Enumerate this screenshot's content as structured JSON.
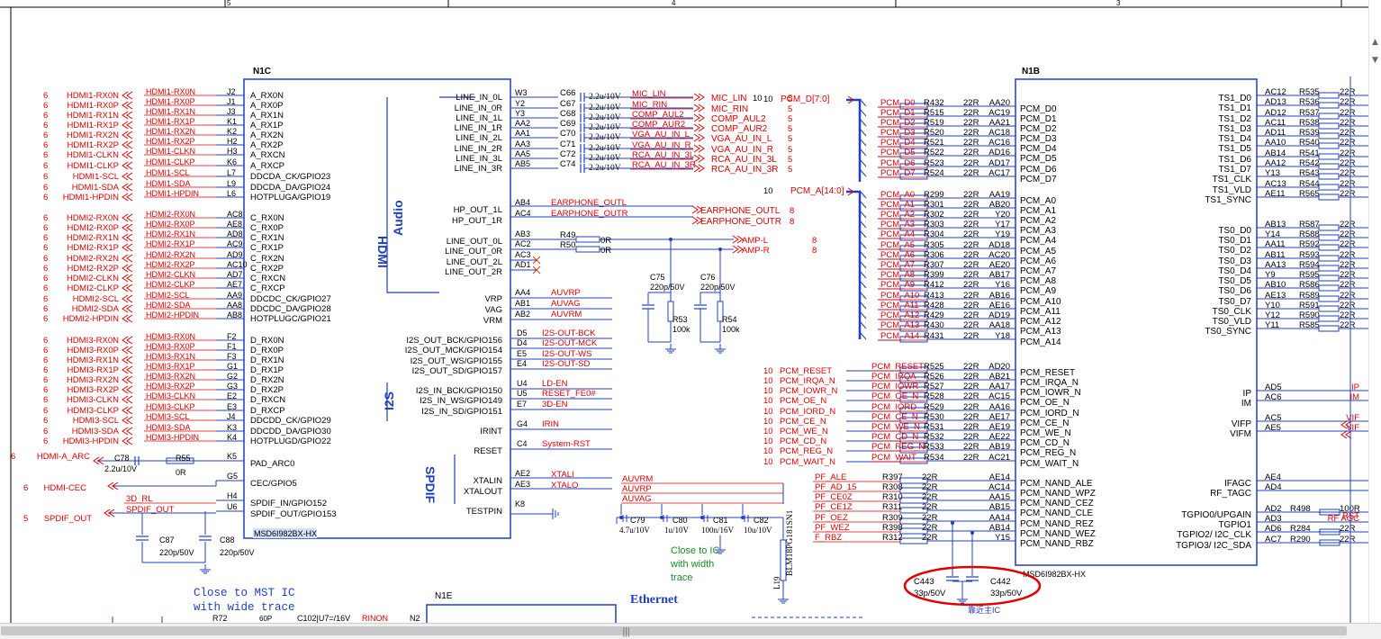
{
  "colors": {
    "wire": "#1f3fbf",
    "label": "#e00000",
    "pin": "#000000",
    "ring": "#e00000"
  },
  "frame": {
    "cols": [
      "5",
      "4",
      "3"
    ]
  },
  "n1c": {
    "title": "N1C",
    "part": "MSD6I982BX-HX",
    "section_audio": "Audio",
    "section_audio2": "HDMI",
    "section_i2s": "I2S",
    "section_spdif": "SPDIF",
    "left": [
      {
        "ball": "J2",
        "pin": "A_RX0N",
        "net": "HDMI1-RX0N",
        "ext": "HDMI1-RX0N",
        "sheet": "6"
      },
      {
        "ball": "J1",
        "pin": "A_RX0P",
        "net": "HDMI1-RX0P",
        "ext": "HDMI1-RX0P",
        "sheet": "6"
      },
      {
        "ball": "J3",
        "pin": "A_RX1N",
        "net": "HDMI1-RX1N",
        "ext": "HDMI1-RX1N",
        "sheet": "6"
      },
      {
        "ball": "K1",
        "pin": "A_RX1P",
        "net": "HDMI1-RX1P",
        "ext": "HDMI1-RX1P",
        "sheet": "6"
      },
      {
        "ball": "K2",
        "pin": "A_RX2N",
        "net": "HDMI1-RX2N",
        "ext": "HDMI1-RX2N",
        "sheet": "6"
      },
      {
        "ball": "H2",
        "pin": "A_RX2P",
        "net": "HDMI1-RX2P",
        "ext": "HDMI1-RX2P",
        "sheet": "6"
      },
      {
        "ball": "H3",
        "pin": "A_RXCN",
        "net": "HDMI1-CLKN",
        "ext": "HDMI1-CLKN",
        "sheet": "6"
      },
      {
        "ball": "K6",
        "pin": "A_RXCP",
        "net": "HDMI1-CLKP",
        "ext": "HDMI1-CLKP",
        "sheet": "6"
      },
      {
        "ball": "L7",
        "pin": "DDCDA_CK/GPIO23",
        "net": "HDMI1-SCL",
        "ext": "HDMI1-SCL",
        "sheet": "6"
      },
      {
        "ball": "L9",
        "pin": "DDCDA_DA/GPIO24",
        "net": "HDMI1-SDA",
        "ext": "HDMI1-SDA",
        "sheet": "6"
      },
      {
        "ball": "L6",
        "pin": "HOTPLUGA/GPIO19",
        "net": "HDMI1-HPDIN",
        "ext": "HDMI1-HPDIN",
        "sheet": "6"
      },
      {
        "ball": "AC8",
        "pin": "C_RX0N",
        "net": "HDMI2-RX0N",
        "ext": "HDMI2-RX0N",
        "sheet": "6"
      },
      {
        "ball": "AE8",
        "pin": "C_RX0P",
        "net": "HDMI2-RX0P",
        "ext": "HDMI2-RX0P",
        "sheet": "6"
      },
      {
        "ball": "AD8",
        "pin": "C_RX1N",
        "net": "HDMI2-RX1N",
        "ext": "HDMI2-RX1N",
        "sheet": "6"
      },
      {
        "ball": "AC9",
        "pin": "C_RX1P",
        "net": "HDMI2-RX1P",
        "ext": "HDMI2-RX1P",
        "sheet": "6"
      },
      {
        "ball": "AD9",
        "pin": "C_RX2N",
        "net": "HDMI2-RX2N",
        "ext": "HDMI2-RX2N",
        "sheet": "6"
      },
      {
        "ball": "AC10",
        "pin": "C_RX2P",
        "net": "HDMI2-RX2P",
        "ext": "HDMI2-RX2P",
        "sheet": "6"
      },
      {
        "ball": "AD7",
        "pin": "C_RXCN",
        "net": "HDMI2-CLKN",
        "ext": "HDMI2-CLKN",
        "sheet": "6"
      },
      {
        "ball": "AE7",
        "pin": "C_RXCP",
        "net": "HDMI2-CLKP",
        "ext": "HDMI2-CLKP",
        "sheet": "6"
      },
      {
        "ball": "AA9",
        "pin": "DDCDC_CK/GPIO27",
        "net": "HDMI2-SCL",
        "ext": "HDMI2-SCL",
        "sheet": "6"
      },
      {
        "ball": "AA8",
        "pin": "DDCDC_DA/GPIO28",
        "net": "HDMI2-SDA",
        "ext": "HDMI2-SDA",
        "sheet": "6"
      },
      {
        "ball": "AB8",
        "pin": "HOTPLUGC/GPIO21",
        "net": "HDMI2-HPDIN",
        "ext": "HDMI2-HPDIN",
        "sheet": "6"
      },
      {
        "ball": "F2",
        "pin": "D_RX0N",
        "net": "HDMI3-RX0N",
        "ext": "HDMI3-RX0N",
        "sheet": "6"
      },
      {
        "ball": "F1",
        "pin": "D_RX0P",
        "net": "HDMI3-RX0P",
        "ext": "HDMI3-RX0P",
        "sheet": "6"
      },
      {
        "ball": "F3",
        "pin": "D_RX1N",
        "net": "HDMI3-RX1N",
        "ext": "HDMI3-RX1N",
        "sheet": "6"
      },
      {
        "ball": "G1",
        "pin": "D_RX1P",
        "net": "HDMI3-RX1P",
        "ext": "HDMI3-RX1P",
        "sheet": "6"
      },
      {
        "ball": "G2",
        "pin": "D_RX2N",
        "net": "HDMI3-RX2N",
        "ext": "HDMI3-RX2N",
        "sheet": "6"
      },
      {
        "ball": "G3",
        "pin": "D_RX2P",
        "net": "HDMI3-RX2P",
        "ext": "HDMI3-RX2P",
        "sheet": "6"
      },
      {
        "ball": "E2",
        "pin": "D_RXCN",
        "net": "HDMI3-CLKN",
        "ext": "HDMI3-CLKN",
        "sheet": "6"
      },
      {
        "ball": "E3",
        "pin": "D_RXCP",
        "net": "HDMI3-CLKP",
        "ext": "HDMI3-CLKP",
        "sheet": "6"
      },
      {
        "ball": "J4",
        "pin": "DDCDD_CK/GPIO29",
        "net": "HDMI3-SCL",
        "ext": "HDMI3-SCL",
        "sheet": "6"
      },
      {
        "ball": "K3",
        "pin": "DDCDD_DA/GPIO30",
        "net": "HDMI3-SDA",
        "ext": "HDMI3-SDA",
        "sheet": "6"
      },
      {
        "ball": "K4",
        "pin": "HOTPLUGD/GPIO22",
        "net": "HDMI3-HPDIN",
        "ext": "HDMI3-HPDIN",
        "sheet": "6"
      }
    ],
    "left_misc": [
      {
        "ball": "K5",
        "pin": "PAD_ARC0",
        "ext": "HDMI-A_ARC",
        "sheet": "6"
      },
      {
        "ball": "G5",
        "pin": "CEC/GPIO5",
        "ext": "HDMI-CEC",
        "sheet": "6"
      },
      {
        "ball": "H4",
        "pin": "SPDIF_IN/GPIO152",
        "ext": "3D_RL",
        "sheet": ""
      },
      {
        "ball": "U6",
        "pin": "SPDIF_OUT/GPIO153",
        "ext": "SPDIF_OUT",
        "sheet": "5"
      }
    ],
    "right": [
      {
        "ball": "W3",
        "pin": "LINE_IN_0L",
        "ref": "C66",
        "val": "2.2u/10V",
        "net": "MIC_LIN",
        "ext": "MIC_LIN",
        "sheet": "5"
      },
      {
        "ball": "Y2",
        "pin": "LINE_IN_0R",
        "ref": "C67",
        "val": "2.2u/10V",
        "net": "MIC_RIN",
        "ext": "MIC_RIN",
        "sheet": "5"
      },
      {
        "ball": "Y3",
        "pin": "LINE_IN_1L",
        "ref": "C68",
        "val": "2.2u/10V",
        "net": "COMP_AUL2",
        "ext": "COMP_AUL2",
        "sheet": "5"
      },
      {
        "ball": "AA2",
        "pin": "LINE_IN_1R",
        "ref": "C69",
        "val": "2.2u/10V",
        "net": "COMP_AUR2",
        "ext": "COMP_AUR2",
        "sheet": "5"
      },
      {
        "ball": "AA1",
        "pin": "LINE_IN_2L",
        "ref": "C70",
        "val": "2.2u/10V",
        "net": "VGA_AU_IN_L",
        "ext": "VGA_AU_IN_L",
        "sheet": "5"
      },
      {
        "ball": "AA3",
        "pin": "LINE_IN_2R",
        "ref": "C71",
        "val": "2.2u/10V",
        "net": "VGA_AU_IN_R",
        "ext": "VGA_AU_IN_R",
        "sheet": "5"
      },
      {
        "ball": "AA5",
        "pin": "LINE_IN_3L",
        "ref": "C72",
        "val": "2.2u/10V",
        "net": "RCA_AU_IN_3L",
        "ext": "RCA_AU_IN_3L",
        "sheet": "5"
      },
      {
        "ball": "AB5",
        "pin": "LINE_IN_3R",
        "ref": "C74",
        "val": "2.2u/10V",
        "net": "RCA_AU_IN_3R",
        "ext": "RCA_AU_IN_3R",
        "sheet": "5"
      }
    ],
    "hp": [
      {
        "ball": "AB4",
        "pin": "HP_OUT_1L",
        "net": "EARPHONE_OUTL",
        "sheet": "8"
      },
      {
        "ball": "AC4",
        "pin": "HP_OUT_1R",
        "net": "EARPHONE_OUTR",
        "sheet": "8"
      }
    ],
    "lineout": [
      {
        "ball": "AB3",
        "pin": "LINE_OUT_0L",
        "ref": "R49",
        "val": "0R",
        "ext": "AMP-L",
        "sheet": "8"
      },
      {
        "ball": "AC2",
        "pin": "LINE_OUT_0R",
        "ref": "R50",
        "val": "0R",
        "ext": "AMP-R",
        "sheet": "8"
      },
      {
        "ball": "AC3",
        "pin": "LINE_OUT_2L"
      },
      {
        "ball": "AD1",
        "pin": "LINE_OUT_2R"
      }
    ],
    "vref": [
      {
        "ball": "AA4",
        "pin": "VRP",
        "net": "AUVRP"
      },
      {
        "ball": "AB1",
        "pin": "VAG",
        "net": "AUVAG"
      },
      {
        "ball": "AB2",
        "pin": "VRM",
        "net": "AUVRM"
      }
    ],
    "i2s": [
      {
        "ball": "D5",
        "pin": "I2S_OUT_BCK/GPIO156",
        "net": "I2S-OUT-BCK"
      },
      {
        "ball": "D4",
        "pin": "I2S_OUT_MCK/GPIO154",
        "net": "I2S-OUT-MCK"
      },
      {
        "ball": "E5",
        "pin": "I2S_OUT_WS/GPIO155",
        "net": "I2S-OUT-WS"
      },
      {
        "ball": "E4",
        "pin": "I2S_OUT_SD/GPIO157",
        "net": "I2S-OUT-SD"
      },
      {
        "ball": "U4",
        "pin": "I2S_IN_BCK/GPIO150",
        "net": "LD-EN"
      },
      {
        "ball": "U5",
        "pin": "I2S_IN_WS/GPIO149",
        "net": "RESET_FE0#"
      },
      {
        "ball": "E7",
        "pin": "I2S_IN_SD/GPIO151",
        "net": "3D-EN"
      },
      {
        "ball": "G4",
        "pin": "IRINT",
        "net": "IRIN"
      },
      {
        "ball": "C4",
        "pin": "RESET",
        "net": "System-RST"
      }
    ],
    "xtal": [
      {
        "ball": "AE2",
        "pin": "XTALIN",
        "net": "XTALI"
      },
      {
        "ball": "AE3",
        "pin": "XTALOUT",
        "net": "XTALO"
      },
      {
        "ball": "K8",
        "pin": "TESTPIN",
        "net": ""
      }
    ]
  },
  "passives": {
    "c75": {
      "ref": "C75",
      "val": "220p/50V"
    },
    "c76": {
      "ref": "C76",
      "val": "220p/50V"
    },
    "r53": {
      "ref": "R53",
      "val": "100k"
    },
    "r54": {
      "ref": "R54",
      "val": "100k"
    },
    "c78": {
      "ref": "C78",
      "val": "2.2u/10V"
    },
    "r55": {
      "ref": "R55",
      "val": "0R"
    },
    "c87": {
      "ref": "C87",
      "val": "220p/50V"
    },
    "c88": {
      "ref": "C88",
      "val": "220p/50V"
    },
    "c79": {
      "ref": "C79",
      "val": "4.7u/10V"
    },
    "c80": {
      "ref": "C80",
      "val": "1u/10V"
    },
    "c81": {
      "ref": "C81",
      "val": "100n/16V"
    },
    "c82": {
      "ref": "C82",
      "val": "10u/10V"
    },
    "l19": {
      "ref": "L19",
      "val": "BLM18PG181SN1"
    },
    "c443": {
      "ref": "C443",
      "val": "33p/50V"
    },
    "c442": {
      "ref": "C442",
      "val": "33p/50V"
    },
    "av_nets": [
      "AUVRM",
      "AUVRP",
      "AUVAG"
    ]
  },
  "notes": {
    "close_ic": "Close to IC",
    "with_width": "with width",
    "trace": "trace",
    "mst1": "Close to MST IC",
    "mst2": "with wide trace",
    "ethernet": "Ethernet",
    "n1e": "N1E",
    "cn_text": "靠近主IC"
  },
  "pcm_bus": {
    "pcm_d": "PCM_D[7:0]",
    "pcm_d_sheet": "10",
    "pcm_a": "PCM_A[14:0]",
    "pcm_a_sheet": "10"
  },
  "n1b": {
    "title": "N1B",
    "part": "MSD6I982BX-HX",
    "data": [
      {
        "net": "PCM_D0",
        "ref": "R432",
        "ball": "AA20",
        "pin": "PCM_D0"
      },
      {
        "net": "PCM_D1",
        "ref": "R515",
        "ball": "AC19",
        "pin": "PCM_D1"
      },
      {
        "net": "PCM_D2",
        "ref": "R519",
        "ball": "AA21",
        "pin": "PCM_D2"
      },
      {
        "net": "PCM_D3",
        "ref": "R520",
        "ball": "AC18",
        "pin": "PCM_D3"
      },
      {
        "net": "PCM_D4",
        "ref": "R521",
        "ball": "AC16",
        "pin": "PCM_D4"
      },
      {
        "net": "PCM_D5",
        "ref": "R522",
        "ball": "AD16",
        "pin": "PCM_D5"
      },
      {
        "net": "PCM_D6",
        "ref": "R523",
        "ball": "AD17",
        "pin": "PCM_D6"
      },
      {
        "net": "PCM_D7",
        "ref": "R524",
        "ball": "AC17",
        "pin": "PCM_D7"
      }
    ],
    "addr": [
      {
        "net": "PCM_A0",
        "ref": "R299",
        "ball": "AA19",
        "pin": "PCM_A0"
      },
      {
        "net": "PCM_A1",
        "ref": "R301",
        "ball": "AB20",
        "pin": "PCM_A1"
      },
      {
        "net": "PCM_A2",
        "ref": "R302",
        "ball": "Y20",
        "pin": "PCM_A2"
      },
      {
        "net": "PCM_A3",
        "ref": "R303",
        "ball": "Y17",
        "pin": "PCM_A3"
      },
      {
        "net": "PCM_A4",
        "ref": "R304",
        "ball": "Y19",
        "pin": "PCM_A4"
      },
      {
        "net": "PCM_A5",
        "ref": "R305",
        "ball": "AD18",
        "pin": "PCM_A5"
      },
      {
        "net": "PCM_A6",
        "ref": "R306",
        "ball": "AC20",
        "pin": "PCM_A6"
      },
      {
        "net": "PCM_A7",
        "ref": "R307",
        "ball": "AE20",
        "pin": "PCM_A7"
      },
      {
        "net": "PCM_A8",
        "ref": "R399",
        "ball": "AB17",
        "pin": "PCM_A8"
      },
      {
        "net": "PCM_A9",
        "ref": "R412",
        "ball": "Y16",
        "pin": "PCM_A9"
      },
      {
        "net": "PCM_A10",
        "ref": "R413",
        "ball": "AB16",
        "pin": "PCM_A10"
      },
      {
        "net": "PCM_A11",
        "ref": "R428",
        "ball": "AE16",
        "pin": "PCM_A11"
      },
      {
        "net": "PCM_A12",
        "ref": "R429",
        "ball": "AD19",
        "pin": "PCM_A12"
      },
      {
        "net": "PCM_A13",
        "ref": "R430",
        "ball": "AA18",
        "pin": "PCM_A13"
      },
      {
        "net": "PCM_A14",
        "ref": "R431",
        "ball": "Y18",
        "pin": "PCM_A14"
      }
    ],
    "ctrl": [
      {
        "ext": "PCM_RESET",
        "net": "PCM_RESET",
        "ref": "R525",
        "ball": "AD20",
        "pin": "PCM_RESET",
        "sheet": "10"
      },
      {
        "ext": "PCM_IRQA_N",
        "net": "PCM_IRQA_",
        "ref": "R526",
        "ball": "AB21",
        "pin": "PCM_IRQA_N",
        "sheet": "10"
      },
      {
        "ext": "PCM_IOWR_N",
        "net": "PCM_IOWR_",
        "ref": "R527",
        "ball": "AA17",
        "pin": "PCM_IOWR_N",
        "sheet": "10"
      },
      {
        "ext": "PCM_OE_N",
        "net": "PCM_OE_N",
        "ref": "R528",
        "ball": "AC15",
        "pin": "PCM_OE_N",
        "sheet": "10"
      },
      {
        "ext": "PCM_IORD_N",
        "net": "PCM_IORD_",
        "ref": "R529",
        "ball": "AA16",
        "pin": "PCM_IORD_N",
        "sheet": "10"
      },
      {
        "ext": "PCM_CE_N",
        "net": "PCM_CE_N",
        "ref": "R530",
        "ball": "AE17",
        "pin": "PCM_CE_N",
        "sheet": "10"
      },
      {
        "ext": "PCM_WE_N",
        "net": "PCM_WE_N",
        "ref": "R531",
        "ball": "AE19",
        "pin": "PCM_WE_N",
        "sheet": "10"
      },
      {
        "ext": "PCM_CD_N",
        "net": "PCM_CD_N",
        "ref": "R532",
        "ball": "AE22",
        "pin": "PCM_CD_N",
        "sheet": "10"
      },
      {
        "ext": "PCM_REG_N",
        "net": "PCM_REG_N",
        "ref": "R533",
        "ball": "AB19",
        "pin": "PCM_REG_N",
        "sheet": "10"
      },
      {
        "ext": "PCM_WAIT_N",
        "net": "PCM_WAIT",
        "ref": "R534",
        "ball": "AC21",
        "pin": "PCM_WAIT_N",
        "sheet": "10"
      }
    ],
    "nand": [
      {
        "net": "PF_ALE",
        "ref": "R397",
        "ball": "AE14",
        "pin": "PCM_NAND_ALE"
      },
      {
        "net": "PF_AD_15",
        "ref": "R308",
        "ball": "AC14",
        "pin": "PCM_NAND_WPZ"
      },
      {
        "net": "PF_CE0Z",
        "ref": "R310",
        "ball": "AA15",
        "pin": "PCM_NAND_CEZ"
      },
      {
        "net": "PF_CE1Z",
        "ref": "R311",
        "ball": "AB15",
        "pin": "PCM_NAND_CLE"
      },
      {
        "net": "PF_OEZ",
        "ref": "R309",
        "ball": "AA14",
        "pin": "PCM_NAND_REZ"
      },
      {
        "net": "PF_WEZ",
        "ref": "R398",
        "ball": "AB14",
        "pin": "PCM_NAND_WEZ"
      },
      {
        "net": "F_RBZ",
        "ref": "R312",
        "ball": "Y15",
        "pin": "PCM_NAND_RBZ"
      }
    ],
    "res_val": "22R",
    "ts1": [
      {
        "pin": "TS1_D0",
        "ball": "AC12",
        "ref": "R535"
      },
      {
        "pin": "TS1_D1",
        "ball": "AD13",
        "ref": "R536"
      },
      {
        "pin": "TS1_D2",
        "ball": "AD12",
        "ref": "R537"
      },
      {
        "pin": "TS1_D3",
        "ball": "AC11",
        "ref": "R538"
      },
      {
        "pin": "TS1_D4",
        "ball": "AD11",
        "ref": "R539"
      },
      {
        "pin": "TS1_D5",
        "ball": "AA10",
        "ref": "R540"
      },
      {
        "pin": "TS1_D6",
        "ball": "AB14",
        "ref": "R541"
      },
      {
        "pin": "TS1_D7",
        "ball": "AA12",
        "ref": "R542"
      },
      {
        "pin": "TS1_CLK",
        "ball": "Y13",
        "ref": "R543"
      },
      {
        "pin": "TS1_VLD",
        "ball": "AC13",
        "ref": "R544"
      },
      {
        "pin": "TS1_SYNC",
        "ball": "AE11",
        "ref": "R565"
      }
    ],
    "ts0": [
      {
        "pin": "TS0_D0",
        "ball": "AB13",
        "ref": "R587"
      },
      {
        "pin": "TS0_D1",
        "ball": "Y14",
        "ref": "R588"
      },
      {
        "pin": "TS0_D2",
        "ball": "AA11",
        "ref": "R592"
      },
      {
        "pin": "TS0_D3",
        "ball": "AB11",
        "ref": "R593"
      },
      {
        "pin": "TS0_D4",
        "ball": "AA13",
        "ref": "R594"
      },
      {
        "pin": "TS0_D5",
        "ball": "Y9",
        "ref": "R595"
      },
      {
        "pin": "TS0_D6",
        "ball": "AB10",
        "ref": "R586"
      },
      {
        "pin": "TS0_D7",
        "ball": "AE13",
        "ref": "R589"
      },
      {
        "pin": "TS0_CLK",
        "ball": "Y10",
        "ref": "R591"
      },
      {
        "pin": "TS0_VLD",
        "ball": "Y12",
        "ref": "R590"
      },
      {
        "pin": "TS0_SYNC",
        "ball": "Y11",
        "ref": "R585"
      }
    ],
    "rmisc": [
      {
        "pin": "IP",
        "ball": "AD5",
        "net": "IP"
      },
      {
        "pin": "IM",
        "ball": "AC6",
        "net": "IM"
      },
      {
        "pin": "VIFP",
        "ball": "AC5",
        "net": "VIF"
      },
      {
        "pin": "VIFM",
        "ball": "AE5",
        "net": "VIF"
      },
      {
        "pin": "IFAGC",
        "ball": "AE4",
        "net": ""
      },
      {
        "pin": "RF_TAGC",
        "ball": "AD4",
        "net": ""
      },
      {
        "pin": "TGPIO0/UPGAIN",
        "ball": "AD2",
        "net": "RST",
        "ref": "R498",
        "val": "100R"
      },
      {
        "pin": "TGPIO1",
        "ball": "AD3",
        "net": "RF AGC"
      },
      {
        "pin": "TGPIO2/ I2C_CLK",
        "ball": "AD6",
        "net": "",
        "ref": "R284",
        "val": "22R"
      },
      {
        "pin": "TGPIO3/ I2C_SDA",
        "ball": "AC7",
        "net": "",
        "ref": "R290",
        "val": "22R"
      }
    ]
  },
  "bottom": {
    "r72": "R72",
    "c102": "C102|U7=/16V",
    "rin": "RINON",
    "n2": "N2",
    "sixtyp": "60P"
  }
}
